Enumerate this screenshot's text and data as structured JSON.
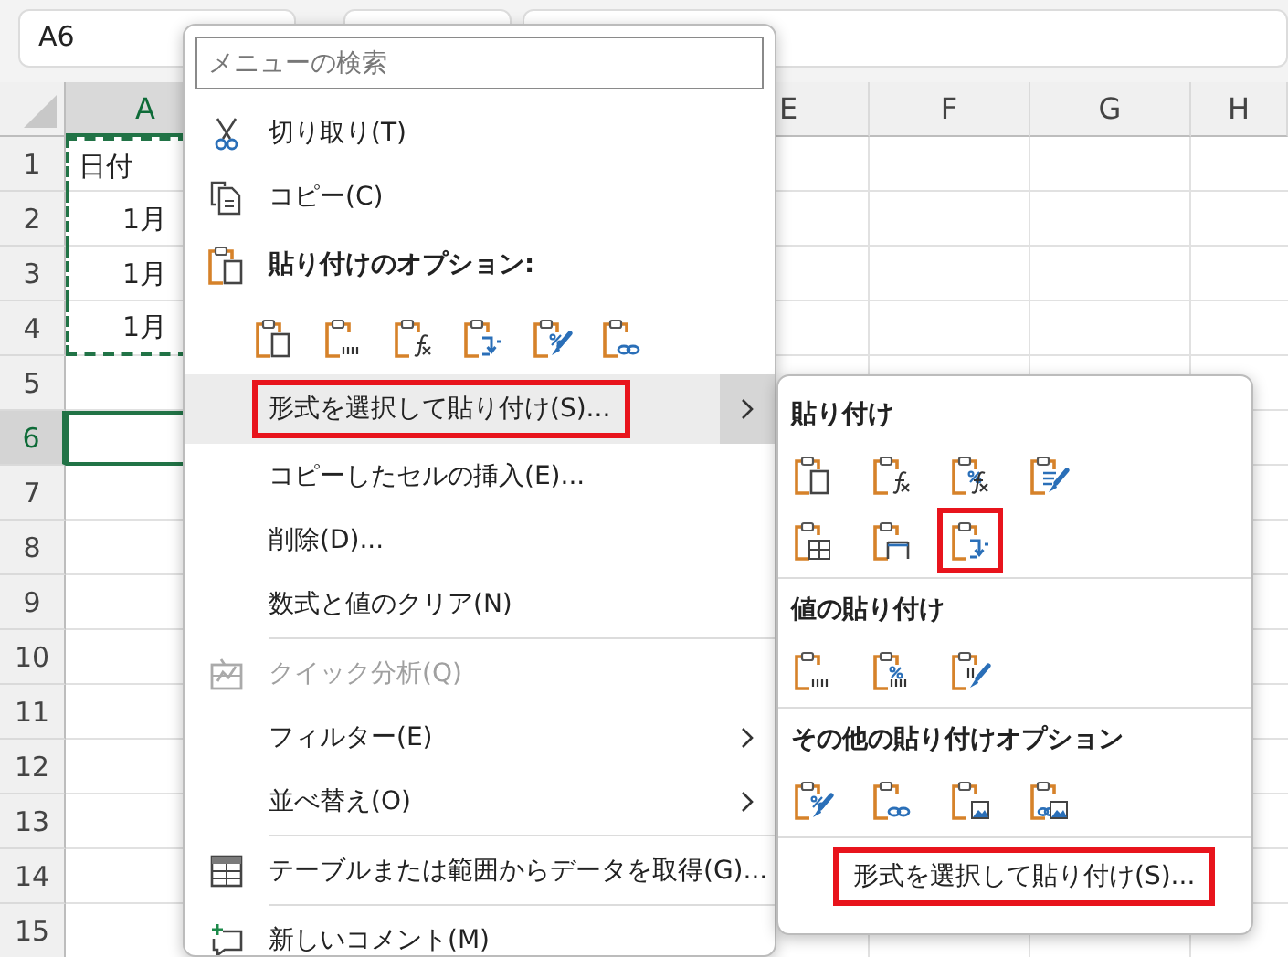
{
  "name_box": {
    "value": "A6"
  },
  "columns_left": [
    {
      "label": "A",
      "selected": true
    }
  ],
  "columns_right": [
    {
      "label": "E",
      "selected": false
    },
    {
      "label": "F",
      "selected": false
    },
    {
      "label": "G",
      "selected": false
    },
    {
      "label": "H",
      "selected": false
    }
  ],
  "rows": [
    {
      "number": "1",
      "cell_a": "日付",
      "kind": "text",
      "selected": false,
      "copied": true
    },
    {
      "number": "2",
      "cell_a": "1月",
      "kind": "date",
      "selected": false,
      "copied": true
    },
    {
      "number": "3",
      "cell_a": "1月",
      "kind": "date",
      "selected": false,
      "copied": true
    },
    {
      "number": "4",
      "cell_a": "1月",
      "kind": "date",
      "selected": false,
      "copied": true
    },
    {
      "number": "5",
      "selected": false,
      "copied": false
    },
    {
      "number": "6",
      "selected": true,
      "copied": false
    },
    {
      "number": "7",
      "selected": false,
      "copied": false
    },
    {
      "number": "8",
      "selected": false,
      "copied": false
    },
    {
      "number": "9",
      "selected": false,
      "copied": false
    },
    {
      "number": "10",
      "selected": false,
      "copied": false
    },
    {
      "number": "11",
      "selected": false,
      "copied": false
    },
    {
      "number": "12",
      "selected": false,
      "copied": false
    },
    {
      "number": "13",
      "selected": false,
      "copied": false
    },
    {
      "number": "14",
      "selected": false,
      "copied": false
    },
    {
      "number": "15",
      "selected": false,
      "copied": false
    }
  ],
  "context_menu": {
    "search": {
      "placeholder": "メニューの検索"
    },
    "items": [
      {
        "kind": "item",
        "label": "切り取り(T)",
        "selected": false,
        "disabled": false,
        "submenu": false,
        "highlighted": false
      },
      {
        "kind": "item",
        "label": "コピー(C)",
        "selected": false,
        "disabled": false,
        "submenu": false,
        "highlighted": false
      },
      {
        "kind": "heading",
        "label": "貼り付けのオプション:"
      },
      {
        "kind": "icons",
        "icons": [
          {
            "kind": "all",
            "highlighted": false
          },
          {
            "kind": "values",
            "highlighted": false
          },
          {
            "kind": "formulas",
            "highlighted": false
          },
          {
            "kind": "transpose",
            "highlighted": false
          },
          {
            "kind": "formatting",
            "highlighted": false
          },
          {
            "kind": "link",
            "highlighted": false
          }
        ]
      },
      {
        "kind": "item",
        "label": "形式を選択して貼り付け(S)...",
        "selected": true,
        "disabled": false,
        "submenu": true,
        "highlighted": true
      },
      {
        "kind": "item",
        "label": "コピーしたセルの挿入(E)...",
        "selected": false,
        "disabled": false,
        "submenu": false,
        "highlighted": false
      },
      {
        "kind": "item",
        "label": "削除(D)...",
        "selected": false,
        "disabled": false,
        "submenu": false,
        "highlighted": false
      },
      {
        "kind": "item",
        "label": "数式と値のクリア(N)",
        "selected": false,
        "disabled": false,
        "submenu": false,
        "highlighted": false
      },
      {
        "kind": "separator"
      },
      {
        "kind": "item",
        "label": "クイック分析(Q)",
        "selected": false,
        "disabled": true,
        "submenu": false,
        "highlighted": false
      },
      {
        "kind": "item",
        "label": "フィルター(E)",
        "selected": false,
        "disabled": false,
        "submenu": true,
        "highlighted": false
      },
      {
        "kind": "item",
        "label": "並べ替え(O)",
        "selected": false,
        "disabled": false,
        "submenu": true,
        "highlighted": false
      },
      {
        "kind": "separator"
      },
      {
        "kind": "item",
        "label": "テーブルまたは範囲からデータを取得(G)...",
        "selected": false,
        "disabled": false,
        "submenu": false,
        "highlighted": false
      },
      {
        "kind": "separator"
      },
      {
        "kind": "item",
        "label": "新しいコメント(M)",
        "selected": false,
        "disabled": false,
        "submenu": false,
        "highlighted": false
      }
    ]
  },
  "submenu": {
    "sections": [
      {
        "heading": "貼り付け",
        "rows": [
          [
            {
              "kind": "all",
              "highlighted": false
            },
            {
              "kind": "formulas",
              "highlighted": false
            },
            {
              "kind": "formulas_number",
              "highlighted": false
            },
            {
              "kind": "keep_source",
              "highlighted": false
            }
          ],
          [
            {
              "kind": "grid",
              "highlighted": false
            },
            {
              "kind": "column_width",
              "highlighted": false
            },
            {
              "kind": "transpose",
              "highlighted": true
            }
          ]
        ]
      },
      {
        "heading": "値の貼り付け",
        "rows": [
          [
            {
              "kind": "values",
              "highlighted": false
            },
            {
              "kind": "values_number",
              "highlighted": false
            },
            {
              "kind": "values_source",
              "highlighted": false
            }
          ]
        ]
      },
      {
        "heading": "その他の貼り付けオプション",
        "rows": [
          [
            {
              "kind": "formatting",
              "highlighted": false
            },
            {
              "kind": "link",
              "highlighted": false
            },
            {
              "kind": "picture",
              "highlighted": false
            },
            {
              "kind": "linked_picture",
              "highlighted": false
            }
          ]
        ]
      }
    ],
    "item": {
      "label": "形式を選択して貼り付け(S)...",
      "highlighted": true
    }
  }
}
